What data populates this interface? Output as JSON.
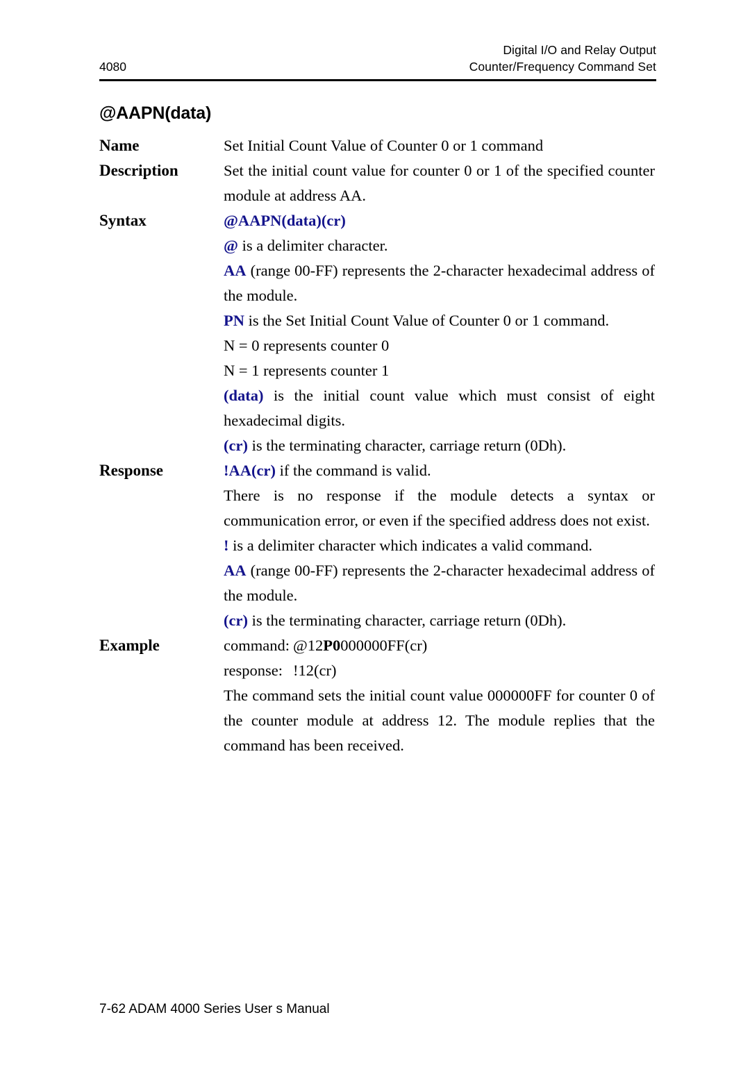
{
  "header": {
    "line1": "Digital I/O and Relay Output",
    "line2": "Counter/Frequency Command Set",
    "page_number": "4080"
  },
  "command": {
    "title": "@AAPN(data)",
    "sections": {
      "name": {
        "label": "Name",
        "text": "Set Initial Count Value of Counter 0 or 1 command"
      },
      "description": {
        "label": "Description",
        "text": "Set the initial count value for counter 0 or 1 of the specified counter module at address AA."
      },
      "syntax": {
        "label": "Syntax",
        "command_line": "@AAPN(data)(cr)",
        "notes": {
          "at_symbol": "@",
          "at_text": " is a delimiter character.",
          "aa_symbol": "AA",
          "aa_text": " (range 00-FF) represents the 2-character hexadecimal address of the module.",
          "pn_symbol": "PN",
          "pn_text": " is the Set Initial Count Value of Counter 0 or 1 command.",
          "n0_line": "N = 0 represents counter 0",
          "n1_line": "N = 1 represents counter 1",
          "data_symbol": "(data)",
          "data_text": " is the initial count value which must consist of eight hexadecimal digits.",
          "cr_symbol": "(cr)",
          "cr_text": " is the terminating character, carriage return (0Dh)."
        }
      },
      "response": {
        "label": "Response",
        "valid_symbol": "!AA(cr)",
        "valid_text": " if the command is valid.",
        "no_response_text": "There is no response if the module detects a syntax or communication error, or even if the specified address does not exist.",
        "bang_symbol": "!",
        "bang_text": " is a delimiter character which indicates a valid command.",
        "aa_symbol": "AA",
        "aa_text": " (range 00-FF) represents the 2-character hexadecimal address of the module.",
        "cr_symbol": "(cr)",
        "cr_text": " is the terminating character, carriage return (0Dh)."
      },
      "example": {
        "label": "Example",
        "command_label": "command:",
        "command_prefix": "@12",
        "command_bold": "P0",
        "command_suffix": "000000FF(cr)",
        "response_label": "response:",
        "response_value": "!12(cr)",
        "explanation": "The command sets the initial count value 000000FF for counter 0 of the counter module at address 12.  The module replies that the command has been received."
      }
    }
  },
  "footer": {
    "text": "7-62 ADAM 4000 Series User s Manual"
  },
  "colors": {
    "accent_blue": "#14148c",
    "text_black": "#000000",
    "page_background": "#ffffff"
  }
}
